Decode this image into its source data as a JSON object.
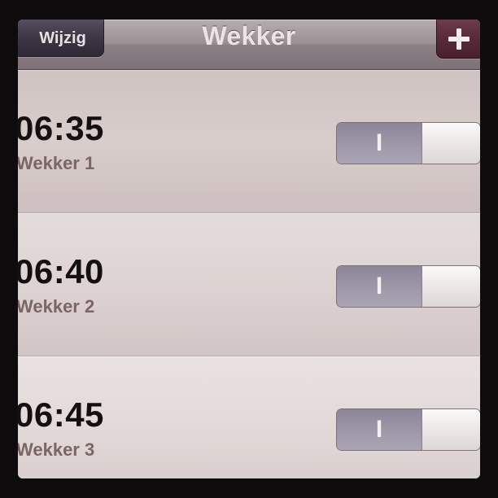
{
  "navbar": {
    "title": "Wekker",
    "edit_label": "Wijzig",
    "add_icon": "plus-icon"
  },
  "alarms": [
    {
      "time": "06:35",
      "label": "Wekker 1",
      "enabled": true,
      "toggle_text": "I"
    },
    {
      "time": "06:40",
      "label": "Wekker 2",
      "enabled": true,
      "toggle_text": "I"
    },
    {
      "time": "06:45",
      "label": "Wekker 3",
      "enabled": true,
      "toggle_text": "I"
    }
  ],
  "colors": {
    "toggle_on": "#9b95a6",
    "add_button": "#5a2b3a",
    "edit_button": "#403847"
  }
}
